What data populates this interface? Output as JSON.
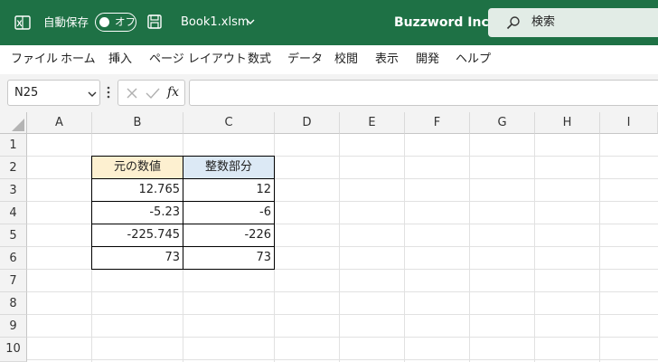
{
  "titlebar": {
    "autosave_label": "自動保存",
    "toggle_label": "オフ",
    "filename": "Book1.xlsm",
    "company": "Buzzword Inc.",
    "search_placeholder": "検索",
    "bg_color": "#1e7145"
  },
  "menu": {
    "items": [
      "ファイル",
      "ホーム",
      "挿入",
      "ページ レイアウト",
      "数式",
      "データ",
      "校閲",
      "表示",
      "開発",
      "ヘルプ"
    ]
  },
  "formula_bar": {
    "name_box": "N25",
    "fx_label": "fx",
    "formula": ""
  },
  "grid": {
    "columns": [
      "A",
      "B",
      "C",
      "D",
      "E",
      "F",
      "G",
      "H",
      "I"
    ],
    "rows": [
      "1",
      "2",
      "3",
      "4",
      "5",
      "6",
      "7",
      "8",
      "9",
      "10"
    ],
    "table": {
      "header_b": "元の数値",
      "header_c": "整数部分",
      "header_b_color": "#fdf0d0",
      "header_c_color": "#dce9f5",
      "values_b": [
        "12.765",
        "-5.23",
        "-225.745",
        "73"
      ],
      "values_c": [
        "12",
        "-6",
        "-226",
        "73"
      ]
    }
  }
}
